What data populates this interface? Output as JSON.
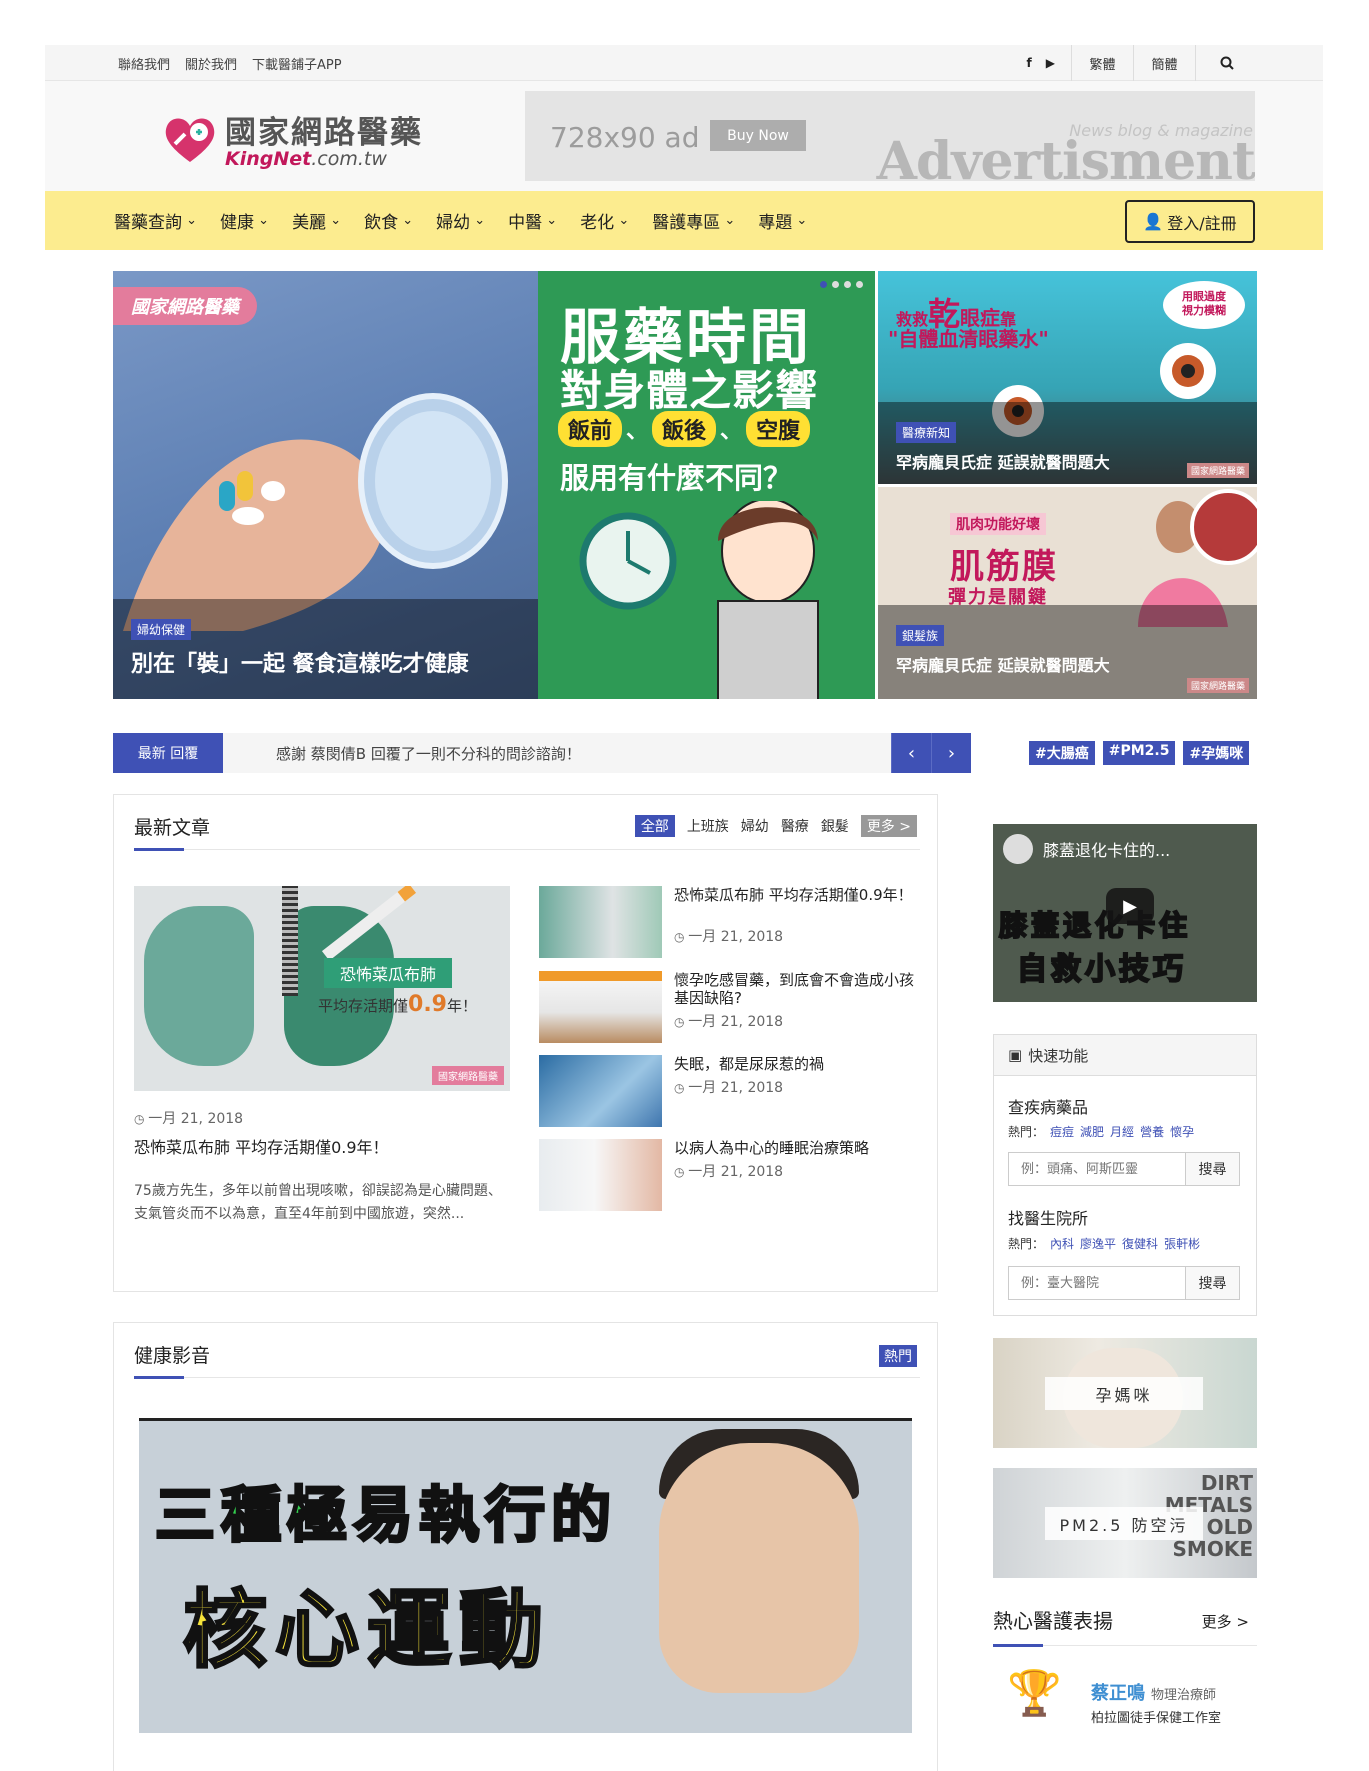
{
  "topbar": {
    "links": [
      "聯絡我們",
      "關於我們",
      "下載醫鋪子APP"
    ],
    "social": [
      "f",
      "▶"
    ],
    "lang_traditional": "繁體",
    "lang_simplified": "簡體",
    "search_icon": "search-icon"
  },
  "logo": {
    "name": "國家網路醫藥",
    "domain_main": "KingNet",
    "domain_tail": ".com.tw"
  },
  "ad": {
    "size": "728x90 ad",
    "button": "Buy Now",
    "tagline": "News blog & magazine",
    "word": "Advertisment"
  },
  "nav": {
    "items": [
      "醫藥查詢",
      "健康",
      "美麗",
      "飲食",
      "婦幼",
      "中醫",
      "老化",
      "醫護專區",
      "專題"
    ],
    "login": "登入/註冊"
  },
  "hero": {
    "main": {
      "watermark": "國家網路醫藥",
      "badge": "婦幼保健",
      "title": "別在「裝」一起 餐食這樣吃才健康"
    },
    "center": {
      "line1": "服藥時間",
      "line2": "對身體之影響",
      "pill1": "飯前",
      "pill2": "飯後",
      "pill3": "空腹",
      "sep": "、",
      "question": "服用有什麼不同？"
    },
    "right_top": {
      "art_1": "救救",
      "art_2": "乾",
      "art_3": "眼症",
      "art_4": "靠",
      "art_5": "\"自體血清眼藥水\"",
      "art_6": "用眼過度",
      "art_7": "視力模糊",
      "badge": "醫療新知",
      "title": "罕病龐貝氏症 延誤就醫問題大"
    },
    "right_bottom": {
      "art_1": "肌肉功能好壞",
      "art_2": "肌筋膜",
      "art_3": "彈力是關鍵",
      "badge": "銀髮族",
      "title": "罕病龐貝氏症 延誤就醫問題大"
    },
    "image_watermark": "國家網路醫藥"
  },
  "ticker": {
    "label": "最新 回覆",
    "text": "感謝 蔡閔倩B 回覆了一則不分科的問診諮詢！"
  },
  "tags": [
    "#大腸癌",
    "#PM2.5",
    "#孕媽咪"
  ],
  "latest": {
    "title": "最新文章",
    "filters": [
      "全部",
      "上班族",
      "婦幼",
      "醫療",
      "銀髮"
    ],
    "more": "更多 >",
    "featured": {
      "ribbon": "恐怖菜瓜布肺",
      "sub_pre": "平均存活期僅",
      "sub_num": "0.9",
      "sub_post": "年！",
      "watermark": "國家網路醫藥",
      "date": "一月 21, 2018",
      "title": "恐怖菜瓜布肺 平均存活期僅0.9年！",
      "excerpt": "75歲方先生，多年以前曾出現咳嗽，卻誤認為是心臟問題、支氣管炎而不以為意，直至4年前到中國旅遊，突然..."
    },
    "list": [
      {
        "title": "恐怖菜瓜布肺 平均存活期僅0.9年！",
        "date": "一月 21, 2018"
      },
      {
        "title": "懷孕吃感冒藥，到底會不會造成小孩基因缺陷?",
        "date": "一月 21, 2018"
      },
      {
        "title": "失眠，都是尿尿惹的禍",
        "date": "一月 21, 2018"
      },
      {
        "title": "以病人為中心的睡眠治療策略",
        "date": "一月 21, 2018"
      }
    ]
  },
  "video_section": {
    "title": "健康影音",
    "hot": "熱門",
    "line1": "三種極易執行的",
    "line2": "核心運動"
  },
  "sidebar": {
    "youtube": {
      "title": "膝蓋退化卡住的...",
      "line1": "膝蓋退化卡住",
      "line2": "自救小技巧"
    },
    "quick": {
      "title": "快速功能",
      "disease": {
        "label": "查疾病藥品",
        "hot_label": "熱門：",
        "hot": [
          "痘痘",
          "減肥",
          "月經",
          "營養",
          "懷孕"
        ],
        "placeholder": "例：頭痛、阿斯匹靈",
        "button": "搜尋"
      },
      "hospital": {
        "label": "找醫生院所",
        "hot_label": "熱門：",
        "hot": [
          "內科",
          "廖逸平",
          "復健科",
          "張軒彬"
        ],
        "placeholder": "例：臺大醫院",
        "button": "搜尋"
      }
    },
    "banners": [
      "孕媽咪",
      "PM2.5 防空污"
    ],
    "praise": {
      "title": "熱心醫護表揚",
      "more": "更多 >",
      "name": "蔡正鳴",
      "role": "物理治療師",
      "workplace": "柏拉圖徒手保健工作室"
    }
  },
  "colors": {
    "accent": "#3f51b5",
    "nav_bg": "#fcec8f",
    "brand_pink": "#c2185b"
  }
}
